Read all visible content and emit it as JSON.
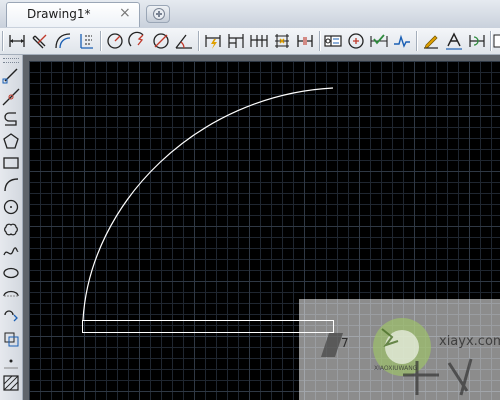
{
  "window": {
    "tab_title": "Drawing1*",
    "tab_close_glyph": "×"
  },
  "toolbar": {
    "items": [
      "linear-dimension-icon",
      "aligned-dimension-icon",
      "arc-length-icon",
      "ordinate-dimension-icon",
      "radius-dimension-icon",
      "jogged-radius-icon",
      "diameter-dimension-icon",
      "angular-dimension-icon",
      "quick-dimension-icon",
      "baseline-dimension-icon",
      "continue-dimension-icon",
      "dimension-space-icon",
      "dimension-break-icon",
      "tolerance-icon",
      "center-mark-icon",
      "inspection-icon",
      "jogged-linear-icon",
      "dimension-edit-icon",
      "dimension-text-edit-icon",
      "dimension-update-icon"
    ]
  },
  "left_toolbar": {
    "items": [
      "line-icon",
      "construction-line-icon",
      "polyline-icon",
      "polygon-icon",
      "rectangle-icon",
      "arc-icon",
      "circle-icon",
      "revision-cloud-icon",
      "spline-icon",
      "ellipse-icon",
      "ellipse-arc-icon",
      "insert-block-icon",
      "make-block-icon",
      "point-icon",
      "hatch-icon"
    ]
  },
  "canvas": {
    "background": "#000000",
    "grid_color": "#1f2630",
    "grid_major_color": "#2f3844",
    "geometry_color": "#ffffff"
  },
  "watermark": {
    "text": "7"
  }
}
